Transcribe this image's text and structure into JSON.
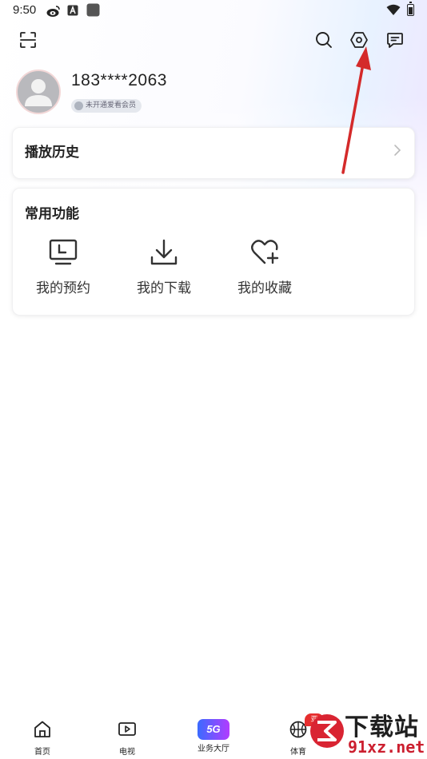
{
  "status_bar": {
    "time": "9:50",
    "icons": [
      "weibo-icon",
      "app-a-icon",
      "app-square-icon",
      "wifi-icon",
      "battery-icon"
    ]
  },
  "toolbar": {
    "icons": [
      "scan-icon",
      "search-icon",
      "settings-icon",
      "message-icon"
    ]
  },
  "profile": {
    "phone": "183****2063",
    "member_badge": "未开通爱看会员"
  },
  "history": {
    "title": "播放历史"
  },
  "functions": {
    "title": "常用功能",
    "items": [
      {
        "label": "我的预约",
        "icon": "tv-reserve-icon"
      },
      {
        "label": "我的下载",
        "icon": "download-icon"
      },
      {
        "label": "我的收藏",
        "icon": "heart-plus-icon"
      }
    ]
  },
  "bottom_nav": {
    "items": [
      {
        "label": "首页",
        "icon": "home-icon"
      },
      {
        "label": "电视",
        "icon": "tv-play-icon"
      },
      {
        "label": "业务大厅",
        "icon": "5g-icon",
        "icon_text": "5G"
      },
      {
        "label": "体育",
        "icon": "basketball-icon",
        "badge": "亚元"
      }
    ]
  },
  "watermark": {
    "line1": "下载站",
    "line2": "91xz.net"
  },
  "colors": {
    "annotation_arrow": "#d42a2a",
    "five_g_gradient_start": "#3a6bff",
    "five_g_gradient_end": "#b23cff",
    "watermark_red": "#cc1f2f"
  }
}
